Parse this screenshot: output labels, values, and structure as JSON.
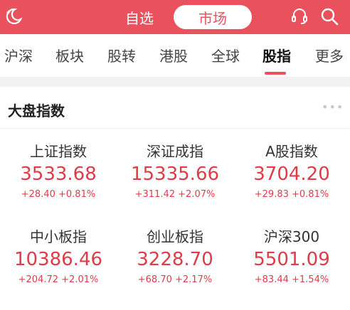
{
  "header": {
    "tab_watchlist": "自选",
    "tab_market": "市场",
    "icons": [
      "moon-icon",
      "customer-service-icon",
      "search-icon"
    ],
    "accent_color": "#e9525c"
  },
  "nav_tabs": [
    {
      "label": "沪深"
    },
    {
      "label": "板块"
    },
    {
      "label": "股转"
    },
    {
      "label": "港股"
    },
    {
      "label": "全球"
    },
    {
      "label": "股指",
      "active": true
    },
    {
      "label": "更多"
    }
  ],
  "section": {
    "title": "大盘指数",
    "indices": [
      {
        "name": "上证指数",
        "value": "3533.68",
        "change": "+28.40",
        "pct": "+0.81%"
      },
      {
        "name": "深证成指",
        "value": "15335.66",
        "change": "+311.42",
        "pct": "+2.07%"
      },
      {
        "name": "A股指数",
        "value": "3704.20",
        "change": "+29.83",
        "pct": "+0.81%"
      },
      {
        "name": "中小板指",
        "value": "10386.46",
        "change": "+204.72",
        "pct": "+2.01%"
      },
      {
        "name": "创业板指",
        "value": "3228.70",
        "change": "+68.70",
        "pct": "+2.17%"
      },
      {
        "name": "沪深300",
        "value": "5501.09",
        "change": "+83.44",
        "pct": "+1.54%"
      }
    ]
  },
  "colors": {
    "up": "#e03b48"
  }
}
